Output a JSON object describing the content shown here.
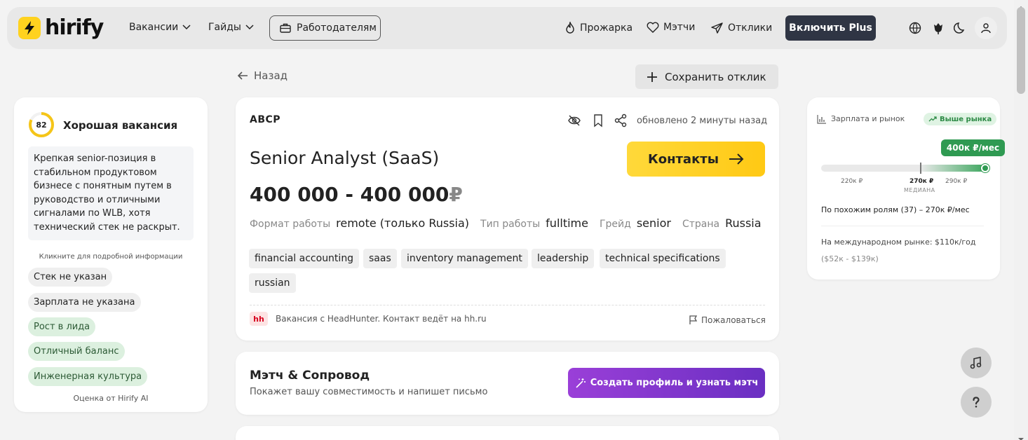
{
  "nav": {
    "logo": "hirify",
    "vacancies": "Вакансии",
    "guides": "Гайды",
    "employers": "Работодателям",
    "roast": "Прожарка",
    "matches": "Мэтчи",
    "responses": "Отклики",
    "plus": "Включить Plus"
  },
  "page": {
    "back": "Назад",
    "save": "Сохранить отклик"
  },
  "assessment": {
    "score": "82",
    "title": "Хорошая вакансия",
    "summary": "Крепкая senior-позиция в стабильном продуктовом бизнесе с понятным путем в руководство и отличными сигналами по WLB, хотя технический стек не раскрыт.",
    "hint": "Кликните для подробной информации",
    "chips": [
      {
        "label": "Стек не указан",
        "tone": "gray"
      },
      {
        "label": "Зарплата не указана",
        "tone": "gray"
      },
      {
        "label": "Рост в лида",
        "tone": "green"
      },
      {
        "label": "Отличный баланс",
        "tone": "green"
      },
      {
        "label": "Инженерная культура",
        "tone": "green"
      }
    ],
    "footer": "Оценка от Hirify AI"
  },
  "job": {
    "company": "ABCP",
    "updated": "обновлено 2 минуты назад",
    "title": "Senior Analyst (SaaS)",
    "contacts": "Контакты",
    "salary": "400 000 - 400 000",
    "currency": "₽",
    "attrs": [
      {
        "label": "Формат работы",
        "value": "remote (только Russia)"
      },
      {
        "label": "Тип работы",
        "value": "fulltime"
      },
      {
        "label": "Грейд",
        "value": "senior"
      },
      {
        "label": "Страна",
        "value": "Russia"
      }
    ],
    "tags": [
      "financial accounting",
      "saas",
      "inventory management",
      "leadership",
      "technical specifications",
      "russian"
    ],
    "source_badge": "hh",
    "source_text": "Вакансия с HeadHunter. Контакт ведёт на hh.ru",
    "report": "Пожаловаться"
  },
  "match": {
    "title": "Мэтч & Сопровод",
    "subtitle": "Покажет вашу совместимость и напишет письмо",
    "button": "Создать профиль и узнать мэтч"
  },
  "market": {
    "title": "Зарплата и рынок",
    "badge": "Выше рынка",
    "bubble": "400к ₽/мес",
    "ticks": [
      "220к ₽",
      "270к ₽",
      "290к ₽"
    ],
    "median_label": "МЕДИАНА",
    "similar": "По похожим ролям (37) – 270к ₽/мес",
    "international": "На международном рынке: $110к/год",
    "range": "($52к - $139к)",
    "position_fraction": 1.0,
    "median_fraction": 0.6
  },
  "colors": {
    "accent_yellow": "#ffd21f",
    "dark": "#2f3544",
    "green": "#2f9a52",
    "purple": "#7a34cc"
  }
}
